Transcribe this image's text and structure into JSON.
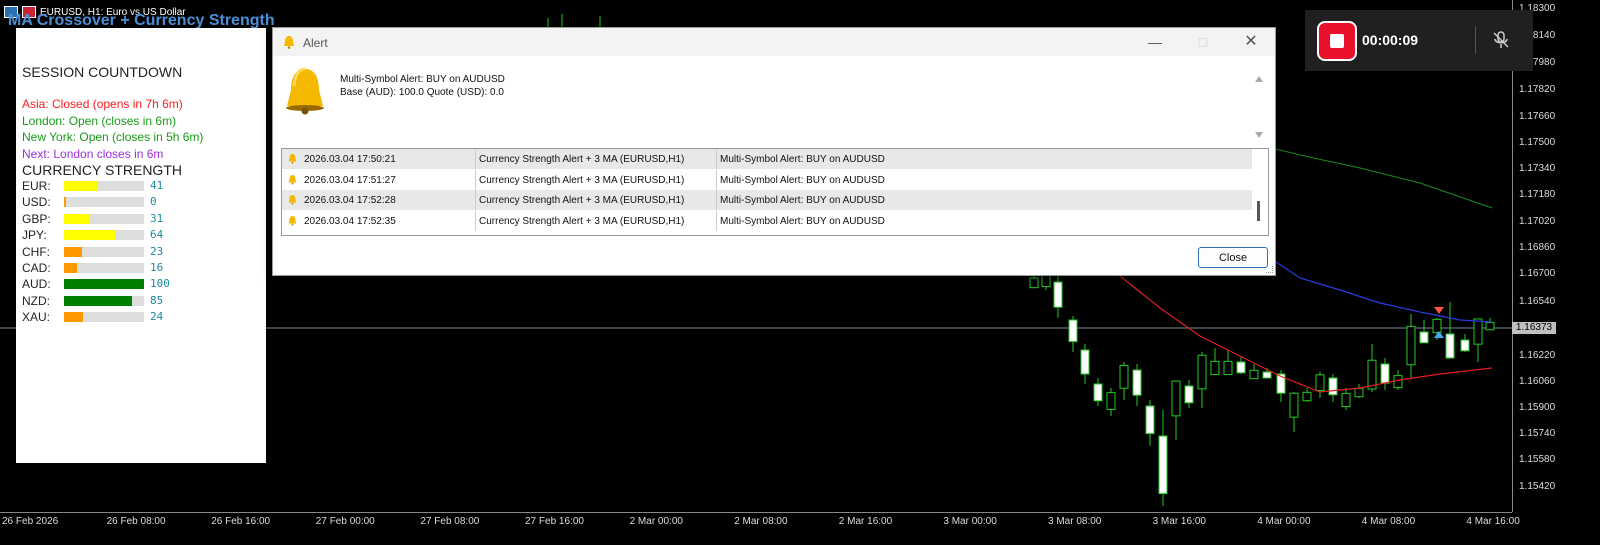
{
  "chart": {
    "header_text": "EURUSD, H1:  Euro vs US Dollar",
    "indicator_title": "MA Crossover + Currency Strength",
    "current_price": "1.16373",
    "price_ticks": [
      "1.18300",
      "1.18140",
      "1.17980",
      "1.17820",
      "1.17660",
      "1.17500",
      "1.17340",
      "1.17180",
      "1.17020",
      "1.16860",
      "1.16700",
      "1.16540",
      "1.16220",
      "1.16060",
      "1.15900",
      "1.15740",
      "1.15580",
      "1.15420"
    ],
    "time_ticks": [
      "26 Feb 2026",
      "26 Feb 08:00",
      "26 Feb 16:00",
      "27 Feb 00:00",
      "27 Feb 08:00",
      "27 Feb 16:00",
      "2 Mar 00:00",
      "2 Mar 08:00",
      "2 Mar 16:00",
      "3 Mar 00:00",
      "3 Mar 08:00",
      "3 Mar 16:00",
      "4 Mar 00:00",
      "4 Mar 08:00",
      "4 Mar 16:00"
    ]
  },
  "panel": {
    "session_title": "SESSION COUNTDOWN",
    "asia": "Asia: Closed (opens in 7h 6m)",
    "london": "London: Open (closes in 6m)",
    "newyork": "New York: Open (closes in 5h 6m)",
    "next": "Next: London closes in 6m",
    "strength_title": "CURRENCY STRENGTH",
    "currencies": [
      {
        "label": "EUR:",
        "value": "41",
        "level": 41,
        "color": "#ffff00"
      },
      {
        "label": "USD:",
        "value": "0",
        "level": 0,
        "color": "#ff9900"
      },
      {
        "label": "GBP:",
        "value": "31",
        "level": 31,
        "color": "#ffff00"
      },
      {
        "label": "JPY:",
        "value": "64",
        "level": 64,
        "color": "#ffff00"
      },
      {
        "label": "CHF:",
        "value": "23",
        "level": 23,
        "color": "#ff9900"
      },
      {
        "label": "CAD:",
        "value": "16",
        "level": 16,
        "color": "#ff9900"
      },
      {
        "label": "AUD:",
        "value": "100",
        "level": 100,
        "color": "#008000"
      },
      {
        "label": "NZD:",
        "value": "85",
        "level": 85,
        "color": "#008000"
      },
      {
        "label": "XAU:",
        "value": "24",
        "level": 24,
        "color": "#ff9900"
      }
    ],
    "colors": {
      "asia": "#ff2020",
      "london": "#1a9a1a",
      "newyork": "#1a9a1a",
      "next": "#9b30d9"
    }
  },
  "dialog": {
    "title": "Alert",
    "message_line1": "Multi-Symbol Alert: BUY on AUDUSD",
    "message_line2": "Base (AUD): 100.0  Quote (USD): 0.0",
    "rows": [
      {
        "time": "2026.03.04 17:50:21",
        "source": "Currency Strength Alert + 3 MA (EURUSD,H1)",
        "message": "Multi-Symbol Alert: BUY on AUDUSD"
      },
      {
        "time": "2026.03.04 17:51:27",
        "source": "Currency Strength Alert + 3 MA (EURUSD,H1)",
        "message": "Multi-Symbol Alert: BUY on AUDUSD"
      },
      {
        "time": "2026.03.04 17:52:28",
        "source": "Currency Strength Alert + 3 MA (EURUSD,H1)",
        "message": "Multi-Symbol Alert: BUY on AUDUSD"
      },
      {
        "time": "2026.03.04 17:52:35",
        "source": "Currency Strength Alert + 3 MA (EURUSD,H1)",
        "message": "Multi-Symbol Alert: BUY on AUDUSD"
      }
    ],
    "close_label": "Close"
  },
  "recorder": {
    "time": "00:00:09",
    "icons": [
      "stop-recording-icon",
      "mic-muted-icon"
    ]
  }
}
